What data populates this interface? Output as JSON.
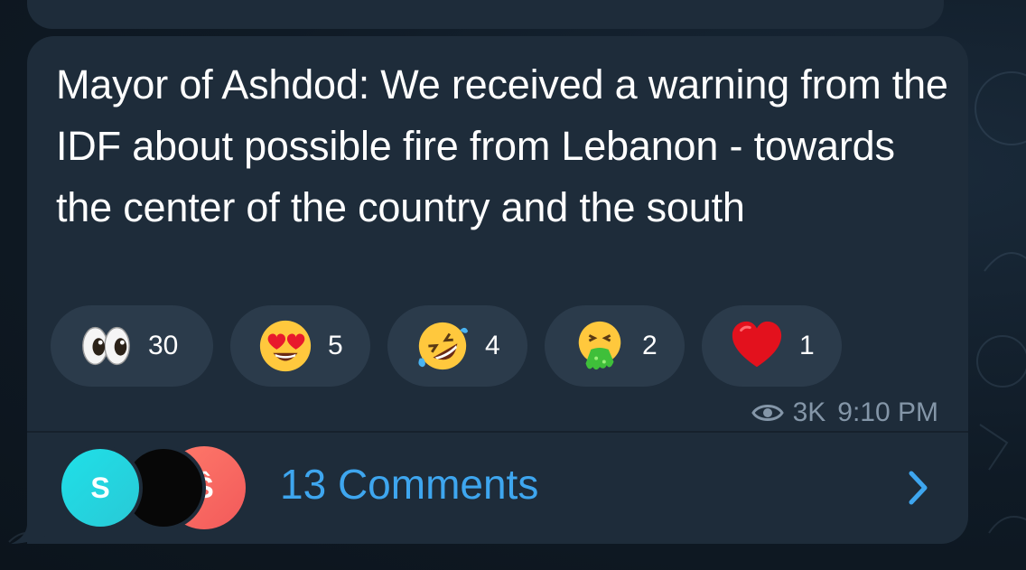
{
  "message": {
    "text": "Mayor of Ashdod: We received a warning from the IDF about possible fire from Lebanon - towards the center of the country and the south",
    "views": "3K",
    "time": "9:10 PM"
  },
  "reactions": [
    {
      "emoji": "eyes",
      "count": "30"
    },
    {
      "emoji": "heart-eyes",
      "count": "5"
    },
    {
      "emoji": "rolling-laughing",
      "count": "4"
    },
    {
      "emoji": "vomiting",
      "count": "2"
    },
    {
      "emoji": "red-heart",
      "count": "1"
    }
  ],
  "comments": {
    "label": "13 Comments",
    "avatars": [
      {
        "initial": "S",
        "color": "#22d3e0"
      },
      {
        "initial": "",
        "color": "#070707"
      },
      {
        "initial": "Ŝ",
        "color": "#f56461"
      }
    ]
  },
  "colors": {
    "bubble": "#1e2c3a",
    "reaction_bg": "#2b3b4b",
    "link": "#3ea6ef",
    "meta": "#8496a8"
  }
}
